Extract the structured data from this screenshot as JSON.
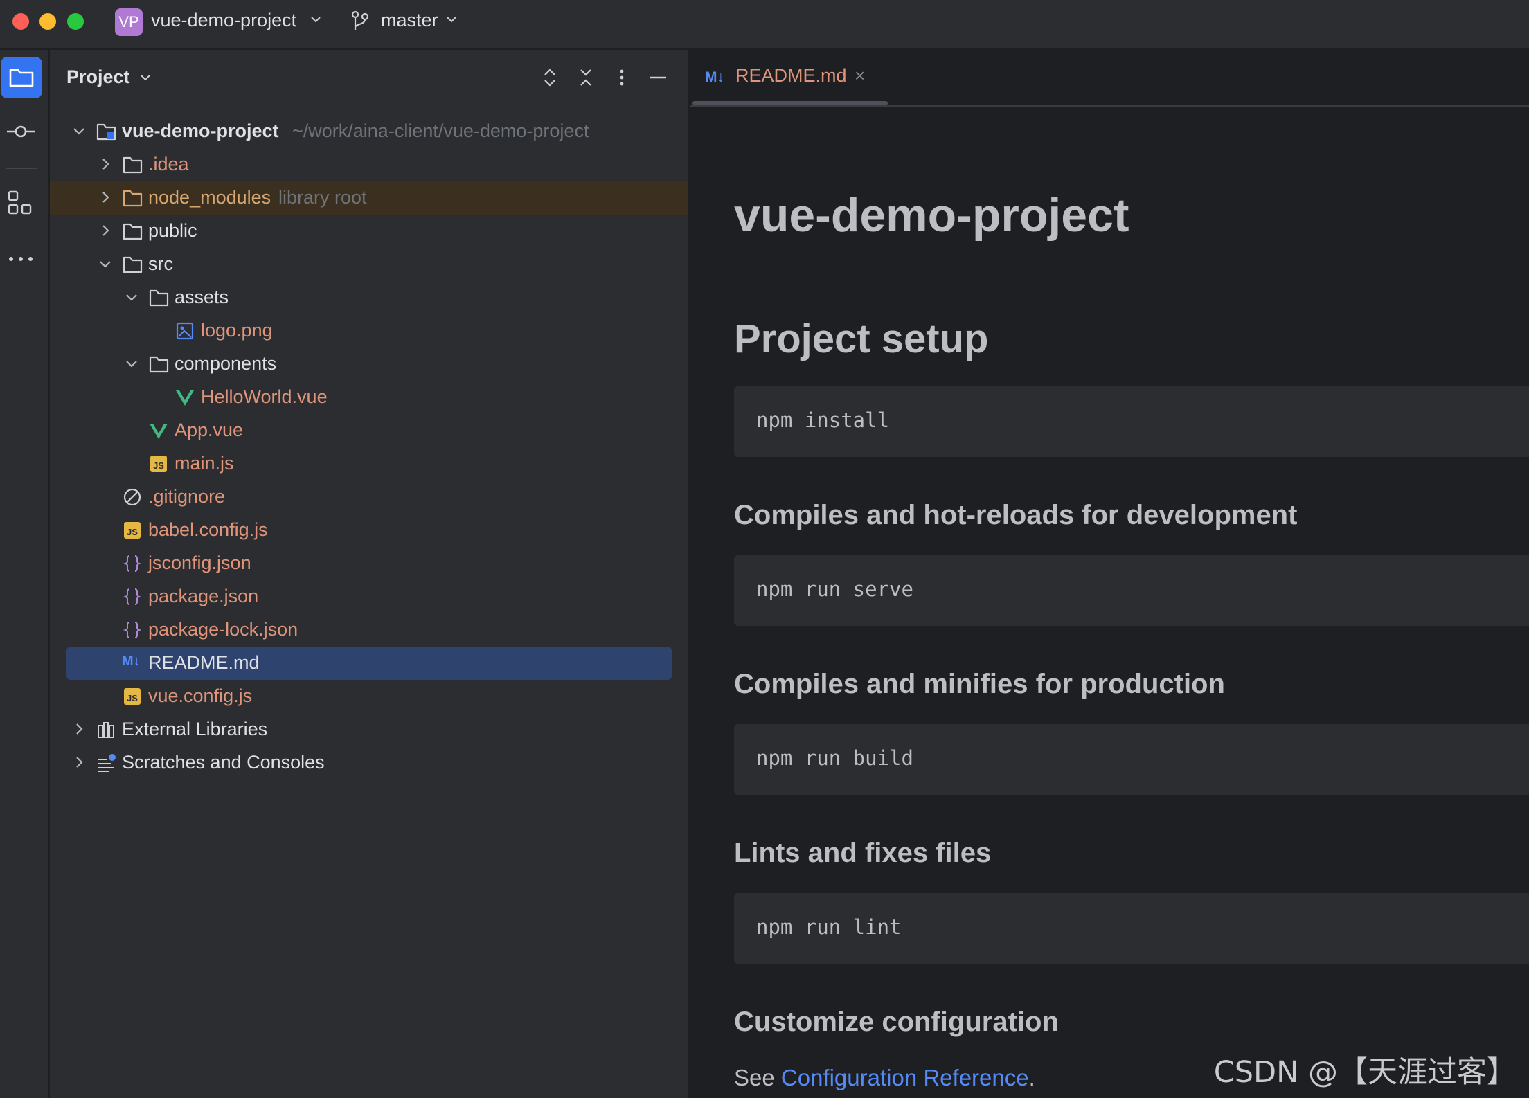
{
  "titlebar": {
    "project_badge": "VP",
    "project_name": "vue-demo-project",
    "branch": "master"
  },
  "toolstrip": {
    "items": [
      "project-icon",
      "commit-icon",
      "structure-icon",
      "more-icon"
    ]
  },
  "project_panel": {
    "title": "Project",
    "tree": [
      {
        "label": "vue-demo-project",
        "hint": "~/work/aina-client/vue-demo-project",
        "icon": "folder-module-icon",
        "expanded": true
      },
      {
        "label": ".idea",
        "icon": "folder-icon",
        "expanded": false
      },
      {
        "label": "node_modules",
        "hint": "library root",
        "icon": "folder-icon",
        "expanded": false
      },
      {
        "label": "public",
        "icon": "folder-icon",
        "expanded": false
      },
      {
        "label": "src",
        "icon": "folder-icon",
        "expanded": true
      },
      {
        "label": "assets",
        "icon": "folder-icon",
        "expanded": true
      },
      {
        "label": "logo.png",
        "icon": "image-file-icon"
      },
      {
        "label": "components",
        "icon": "folder-icon",
        "expanded": true
      },
      {
        "label": "HelloWorld.vue",
        "icon": "vue-file-icon"
      },
      {
        "label": "App.vue",
        "icon": "vue-file-icon"
      },
      {
        "label": "main.js",
        "icon": "js-file-icon"
      },
      {
        "label": ".gitignore",
        "icon": "ignore-file-icon"
      },
      {
        "label": "babel.config.js",
        "icon": "js-file-icon"
      },
      {
        "label": "jsconfig.json",
        "icon": "json-file-icon"
      },
      {
        "label": "package.json",
        "icon": "json-file-icon"
      },
      {
        "label": "package-lock.json",
        "icon": "json-file-icon"
      },
      {
        "label": "README.md",
        "icon": "markdown-file-icon",
        "selected": true
      },
      {
        "label": "vue.config.js",
        "icon": "js-file-icon"
      },
      {
        "label": "External Libraries",
        "icon": "libraries-icon",
        "expanded": false
      },
      {
        "label": "Scratches and Consoles",
        "icon": "scratches-icon",
        "expanded": false
      }
    ]
  },
  "editor": {
    "tab": {
      "icon_text": "M↓",
      "label": "README.md",
      "close": "×"
    },
    "content": {
      "h1": "vue-demo-project",
      "h2": "Project setup",
      "code1": "npm install",
      "h3_1": "Compiles and hot-reloads for development",
      "code2": "npm run serve",
      "h3_2": "Compiles and minifies for production",
      "code3": "npm run build",
      "h3_3": "Lints and fixes files",
      "code4": "npm run lint",
      "h3_4": "Customize configuration",
      "see_prefix": "See ",
      "link_text": "Configuration Reference",
      "see_suffix": "."
    }
  },
  "watermark": "CSDN @【天涯过客】",
  "colors": {
    "accent": "#3574f0",
    "modified_file": "#e0957b",
    "library_root": "#d6a771",
    "link": "#548af7",
    "selection": "#2e436e"
  }
}
